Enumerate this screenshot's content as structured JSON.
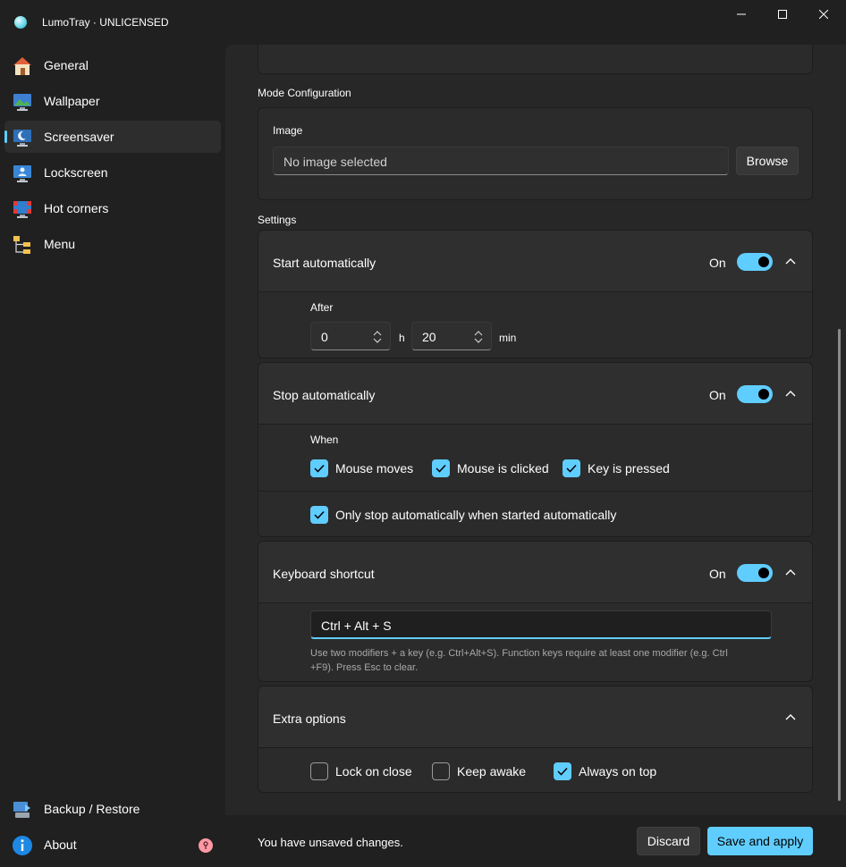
{
  "window": {
    "title": "LumoTray · UNLICENSED"
  },
  "sidebar": {
    "items": [
      {
        "label": "General",
        "icon": "home-icon"
      },
      {
        "label": "Wallpaper",
        "icon": "wallpaper-icon"
      },
      {
        "label": "Screensaver",
        "icon": "screensaver-icon",
        "active": true
      },
      {
        "label": "Lockscreen",
        "icon": "lockscreen-icon"
      },
      {
        "label": "Hot corners",
        "icon": "hot-corners-icon"
      },
      {
        "label": "Menu",
        "icon": "menu-icon"
      }
    ],
    "bottom_items": [
      {
        "label": "Backup / Restore",
        "icon": "backup-icon"
      },
      {
        "label": "About",
        "icon": "info-icon"
      }
    ]
  },
  "mode_config": {
    "section_title": "Mode Configuration",
    "image_label": "Image",
    "image_value": "No image selected",
    "browse_label": "Browse"
  },
  "settings": {
    "section_title": "Settings",
    "start": {
      "title": "Start automatically",
      "state": "On",
      "after_label": "After",
      "hours": "0",
      "hours_unit": "h",
      "minutes": "20",
      "minutes_unit": "min"
    },
    "stop": {
      "title": "Stop automatically",
      "state": "On",
      "when_label": "When",
      "mouse_moves": "Mouse moves",
      "mouse_clicked": "Mouse is clicked",
      "key_pressed": "Key is pressed",
      "only_stop": "Only stop automatically when started automatically"
    },
    "shortcut": {
      "title": "Keyboard shortcut",
      "state": "On",
      "value": "Ctrl + Alt + S",
      "hint_line1": "Use two modifiers + a key (e.g. Ctrl+Alt+S). Function keys require at least one modifier (e.g. Ctrl",
      "hint_line2": "+F9). Press Esc to clear."
    },
    "extra": {
      "title": "Extra options",
      "lock_on_close": "Lock on close",
      "keep_awake": "Keep awake",
      "always_on_top": "Always on top"
    }
  },
  "footer": {
    "status": "You have unsaved changes.",
    "discard": "Discard",
    "save": "Save and apply"
  },
  "colors": {
    "accent": "#60cdff",
    "background": "#202020",
    "card": "#2b2b2b"
  }
}
